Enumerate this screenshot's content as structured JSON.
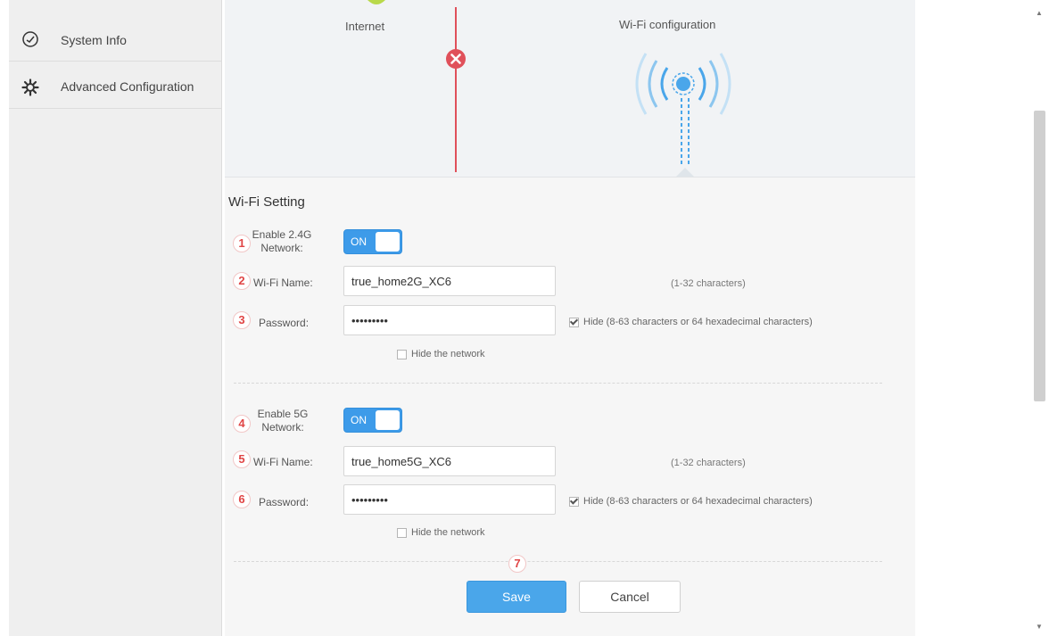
{
  "sidebar": {
    "items": [
      {
        "label": "System Info",
        "icon": "gauge-icon"
      },
      {
        "label": "Advanced Configuration",
        "icon": "gear-icon"
      }
    ]
  },
  "diagram": {
    "internet_label": "Internet",
    "wifi_label": "Wi-Fi configuration",
    "status": "disconnected"
  },
  "wifi": {
    "section_title": "Wi-Fi Setting",
    "band24": {
      "step": "1",
      "enable_label_line1": "Enable 2.4G",
      "enable_label_line2": "Network:",
      "toggle_text": "ON",
      "name_step": "2",
      "name_label": "Wi-Fi Name:",
      "name_value": "true_home2G_XC6",
      "name_hint": "(1-32 characters)",
      "password_step": "3",
      "password_label": "Password:",
      "password_value": "•••••••••",
      "hide_password_label": "Hide (8-63 characters or 64 hexadecimal characters)",
      "hide_password_checked": true,
      "hide_network_label": "Hide the network",
      "hide_network_checked": false
    },
    "band5": {
      "step": "4",
      "enable_label_line1": "Enable 5G",
      "enable_label_line2": "Network:",
      "toggle_text": "ON",
      "name_step": "5",
      "name_label": "Wi-Fi Name:",
      "name_value": "true_home5G_XC6",
      "name_hint": "(1-32 characters)",
      "password_step": "6",
      "password_label": "Password:",
      "password_value": "•••••••••",
      "hide_password_label": "Hide (8-63 characters or 64 hexadecimal characters)",
      "hide_password_checked": true,
      "hide_network_label": "Hide the network",
      "hide_network_checked": false
    },
    "save_step": "7",
    "save_label": "Save",
    "cancel_label": "Cancel"
  },
  "colors": {
    "accent": "#3d9be9",
    "error": "#e0505a",
    "step_marker": "#e04545"
  }
}
